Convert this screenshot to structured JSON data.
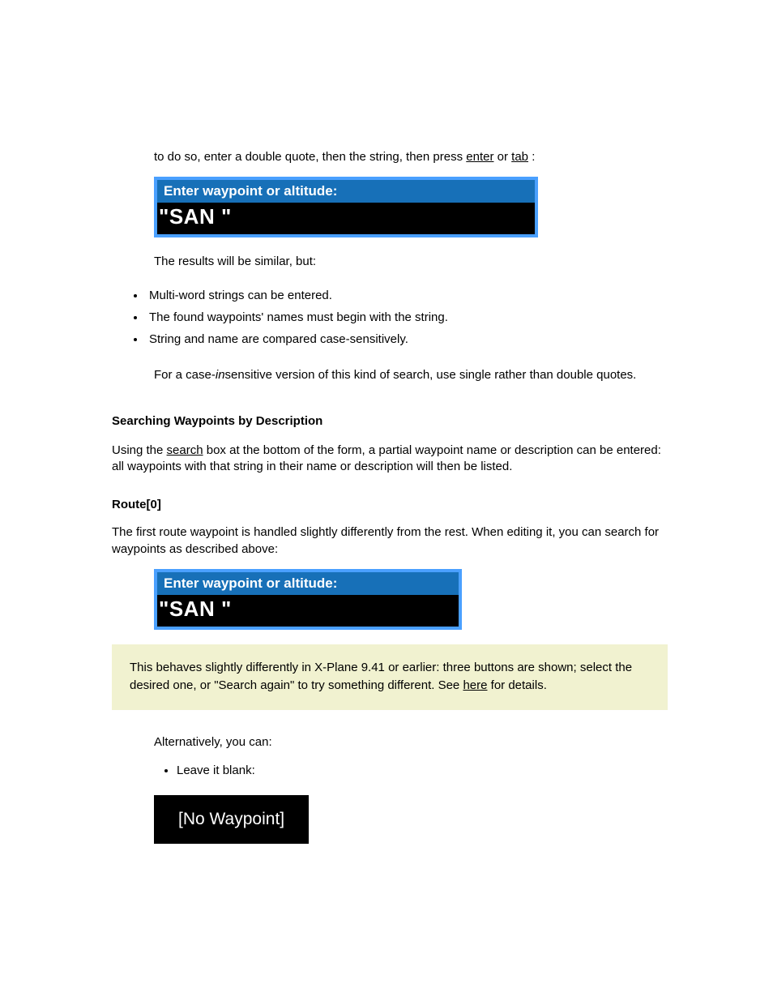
{
  "intro": {
    "part1": "to do so, enter a double quote, then the string, then press ",
    "link1": "enter",
    "part2": " or ",
    "link2": "tab",
    "part3": ":"
  },
  "waypointBox1": {
    "title": "Enter waypoint or altitude:",
    "value": "\"SAN \""
  },
  "resultsIntro": "The results will be similar, but:",
  "bulletsA": [
    "Multi-word strings can be entered.",
    "The found waypoints' names must begin with the string.",
    "String and name are compared case-sensitively."
  ],
  "para2": {
    "part1": "For a case-",
    "emph": "in",
    "part2": "sensitive version of this kind of search, use single rather than double quotes."
  },
  "searchingHeading": "Searching Waypoints by Description",
  "para3": {
    "part1": "Using the ",
    "link": "search",
    "part2": " box at the bottom of the form, a partial waypoint name or description can be entered: all waypoints with that string in their name or description will then be listed."
  },
  "route0Heading": "Route[0]",
  "route0Para": "The first route waypoint is handled slightly differently from the rest. When editing it, you can search for waypoints as described above:",
  "waypointBox2": {
    "title": "Enter waypoint or altitude:",
    "value": "\"SAN \""
  },
  "note": {
    "part1": "This behaves slightly differently in X-Plane 9.41 or earlier: three buttons are shown; select the desired one, or \"Search again\" to try something different. See ",
    "link": "here",
    "part2": " for details."
  },
  "alternativelyIntro": "Alternatively, you can:",
  "bulletsB": [
    "Leave it blank:"
  ],
  "noWaypointLabel": "[No Waypoint]"
}
